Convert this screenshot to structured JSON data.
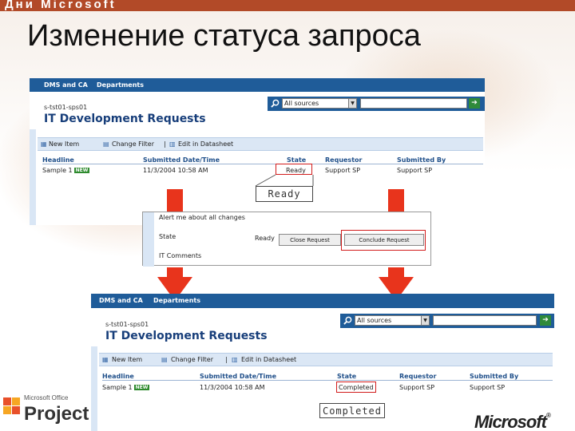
{
  "slide": {
    "brand_top": "Дни Microsoft",
    "title": "Изменение статуса запроса"
  },
  "screen_top": {
    "nav": [
      "DMS and CA",
      "Departments"
    ],
    "site": "s-tst01-sps01",
    "title": "IT Development Requests",
    "search_scope": "All sources",
    "toolbar": {
      "new_item": "New Item",
      "change_filter": "Change Filter",
      "sep": "|",
      "edit_datasheet": "Edit in Datasheet"
    },
    "columns": [
      "Headline",
      "Submitted Date/Time",
      "State",
      "Requestor",
      "Submitted By"
    ],
    "row": {
      "headline": "Sample 1",
      "badge": "NEW",
      "date": "11/3/2004 10:58 AM",
      "state": "Ready",
      "requestor": "Support SP",
      "submitted_by": "Support SP"
    },
    "callout": "Ready"
  },
  "form_panel": {
    "alert_label": "Alert me about all changes",
    "state_label": "State",
    "state_value": "Ready",
    "close_button": "Close Request",
    "conclude_button": "Conclude Request",
    "comments_label": "IT Comments"
  },
  "screen_bottom": {
    "nav": [
      "DMS and CA",
      "Departments"
    ],
    "site": "s-tst01-sps01",
    "title": "IT Development Requests",
    "search_scope": "All sources",
    "toolbar": {
      "new_item": "New Item",
      "change_filter": "Change Filter",
      "sep": "|",
      "edit_datasheet": "Edit in Datasheet"
    },
    "columns": [
      "Headline",
      "Submitted Date/Time",
      "State",
      "Requestor",
      "Submitted By"
    ],
    "row": {
      "headline": "Sample 1",
      "badge": "NEW",
      "date": "11/3/2004 10:58 AM",
      "state": "Completed",
      "requestor": "Support SP",
      "submitted_by": "Support SP"
    },
    "callout": "Completed"
  },
  "footer": {
    "office_small": "Microsoft Office",
    "project": "Project",
    "microsoft": "Microsoft",
    "tm": "®"
  },
  "colors": {
    "accent_red": "#d21c1c",
    "sp_blue": "#1f5c99",
    "arrow_red": "#e8341c"
  },
  "icons": [
    "search-icon",
    "go-arrow-icon",
    "new-item-icon",
    "filter-icon",
    "datasheet-icon",
    "flag-icon"
  ]
}
